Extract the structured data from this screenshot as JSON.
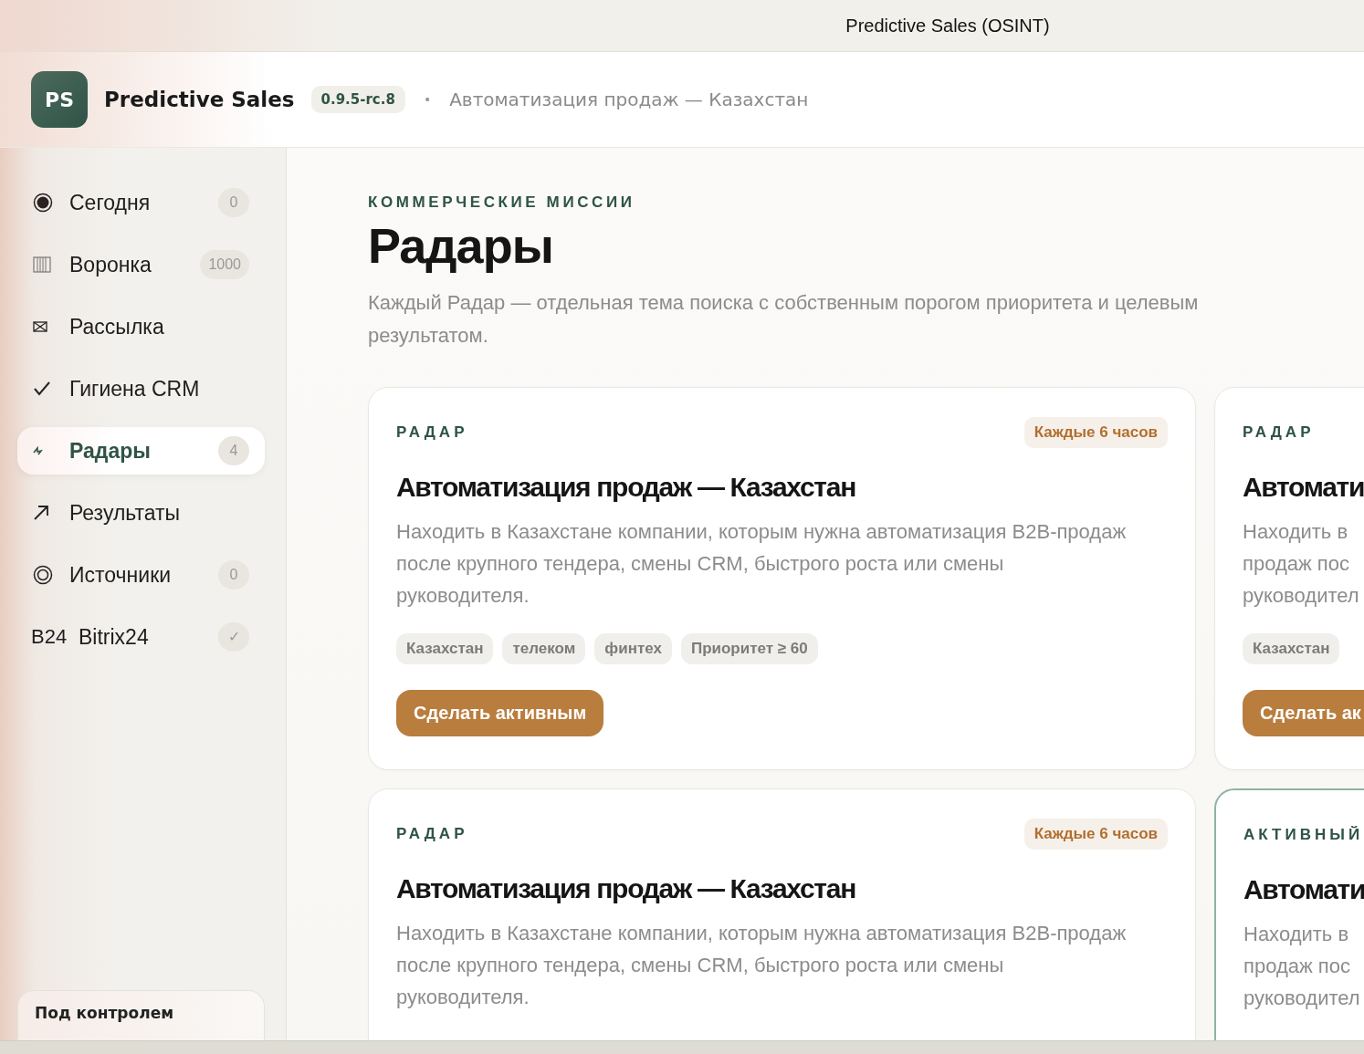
{
  "window": {
    "title": "Predictive Sales (OSINT)"
  },
  "header": {
    "logo": "PS",
    "app_name": "Predictive Sales",
    "version": "0.9.5-rc.8",
    "separator": "•",
    "context": "Автоматизация продаж — Казахстан"
  },
  "sidebar": {
    "items": [
      {
        "label": "Сегодня",
        "count": "0",
        "selected": false
      },
      {
        "label": "Воронка",
        "count": "1000",
        "selected": false
      },
      {
        "label": "Рассылка",
        "selected": false
      },
      {
        "label": "Гигиена CRM",
        "selected": false
      },
      {
        "label": "Радары",
        "count": "4",
        "selected": true
      },
      {
        "label": "Результаты",
        "selected": false
      },
      {
        "label": "Источники",
        "count": "0",
        "selected": false
      },
      {
        "label": "Bitrix24",
        "mark": "B24",
        "count": "✓",
        "selected": false
      }
    ],
    "footer": {
      "title": "Под контролем"
    }
  },
  "page": {
    "eyebrow": "КОММЕРЧЕСКИЕ МИССИИ",
    "title": "Радары",
    "description": "Каждый Радар — отдельная тема поиска с собственным порогом приоритета и целевым результатом."
  },
  "radars": [
    {
      "label": "РАДАР",
      "active": false,
      "schedule": "Каждые 6 часов",
      "title": "Автоматизация продаж — Казахстан",
      "description": "Находить в Казахстане компании, которым нужна автоматизация B2B-продаж после крупного тендера, смены CRM, быстрого роста или смены руководителя.",
      "tags": [
        "Казахстан",
        "телеком",
        "финтех",
        "Приоритет ≥ 60"
      ],
      "action": "Сделать активным"
    },
    {
      "label": "РАДАР",
      "active": false,
      "title": "Автомати",
      "description_lines": [
        "Находить в",
        "продаж пос",
        "руководител"
      ],
      "tags": [
        "Казахстан"
      ],
      "action": "Сделать ак"
    },
    {
      "label": "РАДАР",
      "active": false,
      "schedule": "Каждые 6 часов",
      "title": "Автоматизация продаж — Казахстан",
      "description": "Находить в Казахстане компании, которым нужна автоматизация B2B-продаж после крупного тендера, смены CRM, быстрого роста или смены руководителя."
    },
    {
      "label": "АКТИВНЫЙ",
      "active": true,
      "title": "Автомати",
      "description_lines": [
        "Находить в",
        "продаж пос",
        "руководител"
      ]
    }
  ]
}
